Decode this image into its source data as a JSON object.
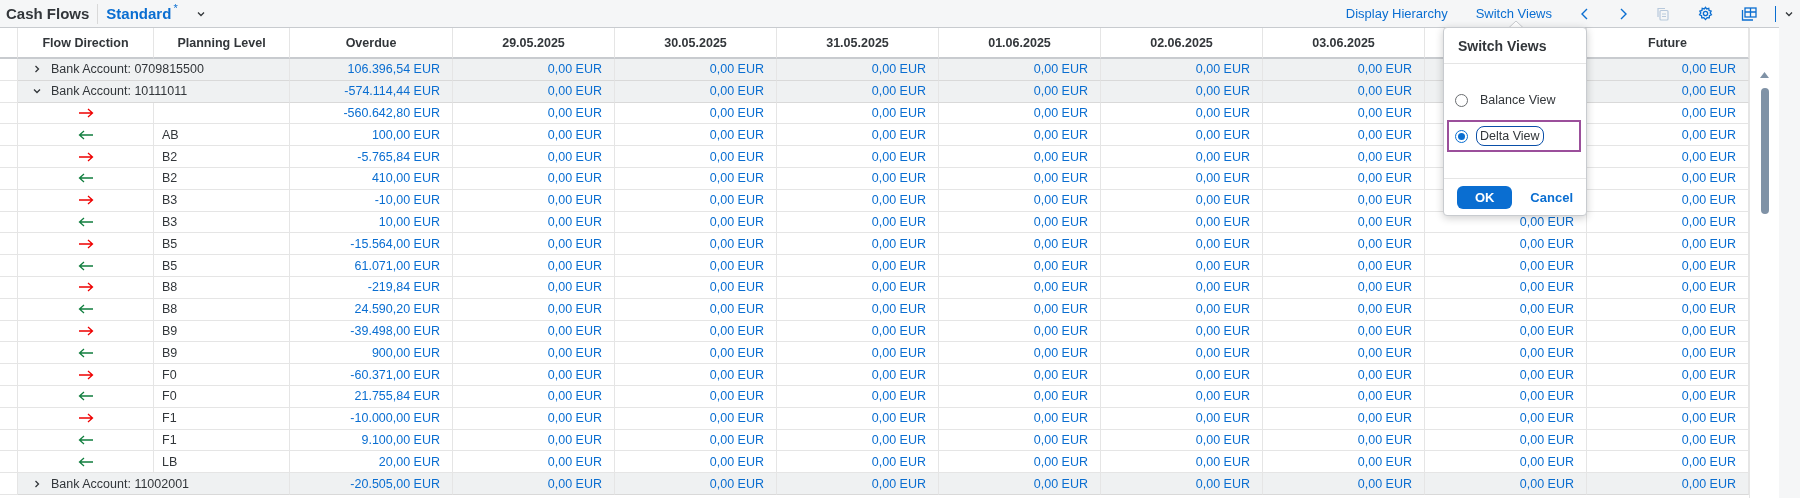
{
  "toolbar": {
    "title": "Cash Flows",
    "variant": "Standard",
    "variant_mark": "*",
    "links": [
      "Display Hierarchy",
      "Switch Views"
    ],
    "copy_disabled": true
  },
  "table": {
    "columns": [
      "Flow Direction",
      "Planning Level",
      "Overdue",
      "29.05.2025",
      "30.05.2025",
      "31.05.2025",
      "01.06.2025",
      "02.06.2025",
      "03.06.2025",
      "Future"
    ],
    "rows": [
      {
        "kind": "group",
        "expanded": false,
        "label": "Bank Account: 0709815500",
        "values": [
          "106.396,54 EUR",
          "0,00 EUR",
          "0,00 EUR",
          "0,00 EUR",
          "0,00 EUR",
          "0,00 EUR",
          "0,00 EUR",
          "0,00 EUR"
        ]
      },
      {
        "kind": "group",
        "expanded": true,
        "label": "Bank Account: 10111011",
        "values": [
          "-574.114,44 EUR",
          "0,00 EUR",
          "0,00 EUR",
          "0,00 EUR",
          "0,00 EUR",
          "0,00 EUR",
          "0,00 EUR",
          "0,00 EUR"
        ]
      },
      {
        "kind": "item",
        "outgoing": true,
        "values": [
          "-560.642,80 EUR",
          "0,00 EUR",
          "0,00 EUR",
          "0,00 EUR",
          "0,00 EUR",
          "0,00 EUR",
          "0,00 EUR",
          "0,00 EUR"
        ]
      },
      {
        "kind": "item",
        "outgoing": false,
        "planning_level": "AB",
        "values": [
          "100,00 EUR",
          "0,00 EUR",
          "0,00 EUR",
          "0,00 EUR",
          "0,00 EUR",
          "0,00 EUR",
          "0,00 EUR",
          "0,00 EUR"
        ]
      },
      {
        "kind": "item",
        "outgoing": true,
        "planning_level": "B2",
        "values": [
          "-5.765,84 EUR",
          "0,00 EUR",
          "0,00 EUR",
          "0,00 EUR",
          "0,00 EUR",
          "0,00 EUR",
          "0,00 EUR",
          "0,00 EUR"
        ]
      },
      {
        "kind": "item",
        "outgoing": false,
        "planning_level": "B2",
        "values": [
          "410,00 EUR",
          "0,00 EUR",
          "0,00 EUR",
          "0,00 EUR",
          "0,00 EUR",
          "0,00 EUR",
          "0,00 EUR",
          "0,00 EUR"
        ]
      },
      {
        "kind": "item",
        "outgoing": true,
        "planning_level": "B3",
        "values": [
          "-10,00 EUR",
          "0,00 EUR",
          "0,00 EUR",
          "0,00 EUR",
          "0,00 EUR",
          "0,00 EUR",
          "0,00 EUR",
          "0,00 EUR"
        ]
      },
      {
        "kind": "item",
        "outgoing": false,
        "planning_level": "B3",
        "column_10": "0,00 EUR",
        "values": [
          "10,00 EUR",
          "0,00 EUR",
          "0,00 EUR",
          "0,00 EUR",
          "0,00 EUR",
          "0,00 EUR",
          "0,00 EUR",
          "0,00 EUR"
        ]
      },
      {
        "kind": "item",
        "outgoing": true,
        "planning_level": "B5",
        "column_10": "0,00 EUR",
        "values": [
          "-15.564,00 EUR",
          "0,00 EUR",
          "0,00 EUR",
          "0,00 EUR",
          "0,00 EUR",
          "0,00 EUR",
          "0,00 EUR",
          "0,00 EUR"
        ]
      },
      {
        "kind": "item",
        "outgoing": false,
        "planning_level": "B5",
        "column_10": "0,00 EUR",
        "values": [
          "61.071,00 EUR",
          "0,00 EUR",
          "0,00 EUR",
          "0,00 EUR",
          "0,00 EUR",
          "0,00 EUR",
          "0,00 EUR",
          "0,00 EUR"
        ]
      },
      {
        "kind": "item",
        "outgoing": true,
        "planning_level": "B8",
        "column_10": "0,00 EUR",
        "values": [
          "-219,84 EUR",
          "0,00 EUR",
          "0,00 EUR",
          "0,00 EUR",
          "0,00 EUR",
          "0,00 EUR",
          "0,00 EUR",
          "0,00 EUR"
        ]
      },
      {
        "kind": "item",
        "outgoing": false,
        "planning_level": "B8",
        "column_10": "0,00 EUR",
        "values": [
          "24.590,20 EUR",
          "0,00 EUR",
          "0,00 EUR",
          "0,00 EUR",
          "0,00 EUR",
          "0,00 EUR",
          "0,00 EUR",
          "0,00 EUR"
        ]
      },
      {
        "kind": "item",
        "outgoing": true,
        "planning_level": "B9",
        "column_10": "0,00 EUR",
        "values": [
          "-39.498,00 EUR",
          "0,00 EUR",
          "0,00 EUR",
          "0,00 EUR",
          "0,00 EUR",
          "0,00 EUR",
          "0,00 EUR",
          "0,00 EUR"
        ]
      },
      {
        "kind": "item",
        "outgoing": false,
        "planning_level": "B9",
        "column_10": "0,00 EUR",
        "values": [
          "900,00 EUR",
          "0,00 EUR",
          "0,00 EUR",
          "0,00 EUR",
          "0,00 EUR",
          "0,00 EUR",
          "0,00 EUR",
          "0,00 EUR"
        ]
      },
      {
        "kind": "item",
        "outgoing": true,
        "planning_level": "F0",
        "column_10": "0,00 EUR",
        "values": [
          "-60.371,00 EUR",
          "0,00 EUR",
          "0,00 EUR",
          "0,00 EUR",
          "0,00 EUR",
          "0,00 EUR",
          "0,00 EUR",
          "0,00 EUR"
        ]
      },
      {
        "kind": "item",
        "outgoing": false,
        "planning_level": "F0",
        "column_10": "0,00 EUR",
        "values": [
          "21.755,84 EUR",
          "0,00 EUR",
          "0,00 EUR",
          "0,00 EUR",
          "0,00 EUR",
          "0,00 EUR",
          "0,00 EUR",
          "0,00 EUR"
        ]
      },
      {
        "kind": "item",
        "outgoing": true,
        "planning_level": "F1",
        "column_10": "0,00 EUR",
        "values": [
          "-10.000,00 EUR",
          "0,00 EUR",
          "0,00 EUR",
          "0,00 EUR",
          "0,00 EUR",
          "0,00 EUR",
          "0,00 EUR",
          "0,00 EUR"
        ]
      },
      {
        "kind": "item",
        "outgoing": false,
        "planning_level": "F1",
        "column_10": "0,00 EUR",
        "values": [
          "9.100,00 EUR",
          "0,00 EUR",
          "0,00 EUR",
          "0,00 EUR",
          "0,00 EUR",
          "0,00 EUR",
          "0,00 EUR",
          "0,00 EUR"
        ]
      },
      {
        "kind": "item",
        "outgoing": false,
        "planning_level": "LB",
        "column_10": "0,00 EUR",
        "values": [
          "20,00 EUR",
          "0,00 EUR",
          "0,00 EUR",
          "0,00 EUR",
          "0,00 EUR",
          "0,00 EUR",
          "0,00 EUR",
          "0,00 EUR"
        ]
      },
      {
        "kind": "group",
        "expanded": false,
        "label": "Bank Account: 11002001",
        "column_10": "0,00 EUR",
        "values": [
          "-20.505,00 EUR",
          "0,00 EUR",
          "0,00 EUR",
          "0,00 EUR",
          "0,00 EUR",
          "0,00 EUR",
          "0,00 EUR",
          "0,00 EUR"
        ]
      }
    ]
  },
  "popover": {
    "title": "Switch Views",
    "options": [
      {
        "label": "Balance View",
        "selected": false,
        "highlighted": false
      },
      {
        "label": "Delta View",
        "selected": true,
        "highlighted": true
      }
    ],
    "ok": "OK",
    "cancel": "Cancel"
  }
}
